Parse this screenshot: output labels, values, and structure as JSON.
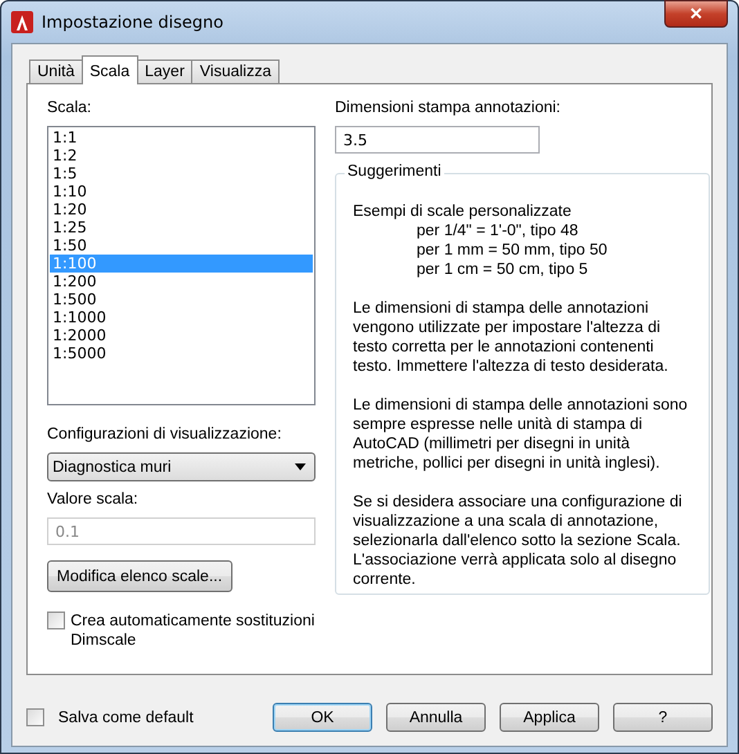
{
  "window": {
    "title": "Impostazione disegno",
    "close": "✕"
  },
  "tabs": [
    {
      "label": "Unità",
      "selected": false
    },
    {
      "label": "Scala",
      "selected": true
    },
    {
      "label": "Layer",
      "selected": false
    },
    {
      "label": "Visualizza",
      "selected": false
    }
  ],
  "scale_list": {
    "label": "Scala:",
    "items": [
      {
        "text": "1:1",
        "selected": false
      },
      {
        "text": "1:2",
        "selected": false
      },
      {
        "text": "1:5",
        "selected": false
      },
      {
        "text": "1:10",
        "selected": false
      },
      {
        "text": "1:20",
        "selected": false
      },
      {
        "text": "1:25",
        "selected": false
      },
      {
        "text": "1:50",
        "selected": false
      },
      {
        "text": "1:100",
        "selected": true
      },
      {
        "text": "1:200",
        "selected": false
      },
      {
        "text": "1:500",
        "selected": false
      },
      {
        "text": "1:1000",
        "selected": false
      },
      {
        "text": "1:2000",
        "selected": false
      },
      {
        "text": "1:5000",
        "selected": false
      }
    ]
  },
  "display_config": {
    "label": "Configurazioni di visualizzazione:",
    "value": "Diagnostica muri"
  },
  "scale_value": {
    "label": "Valore scala:",
    "value": "0.1",
    "disabled": true
  },
  "edit_scales_button": "Modifica elenco scale...",
  "auto_dimscale": {
    "label": "Crea automaticamente sostituzioni Dimscale",
    "checked": false
  },
  "annotation_size": {
    "label": "Dimensioni stampa annotazioni:",
    "value": "3.5"
  },
  "hints": {
    "title": "Suggerimenti",
    "examples_title": "Esempi di scale personalizzate",
    "examples": [
      "per 1/4\" = 1'-0\", tipo 48",
      "per 1 mm = 50 mm, tipo 50",
      "per 1 cm = 50 cm, tipo 5"
    ],
    "paragraphs": [
      "Le dimensioni di stampa delle annotazioni vengono utilizzate per impostare l'altezza di testo corretta per le annotazioni contenenti testo. Immettere l'altezza di testo desiderata.",
      "Le dimensioni di stampa delle annotazioni sono sempre espresse nelle unità di stampa di AutoCAD (millimetri per disegni in unità metriche, pollici per disegni in unità inglesi).",
      "Se si desidera associare una configurazione di visualizzazione a una scala di annotazione, selezionarla dall'elenco sotto la sezione Scala. L'associazione verrà applicata solo al disegno corrente."
    ]
  },
  "save_default": {
    "label": "Salva come default",
    "checked": false
  },
  "buttons": [
    {
      "label": "OK",
      "default": true
    },
    {
      "label": "Annulla",
      "default": false
    },
    {
      "label": "Applica",
      "default": false
    },
    {
      "label": "?",
      "default": false
    }
  ]
}
